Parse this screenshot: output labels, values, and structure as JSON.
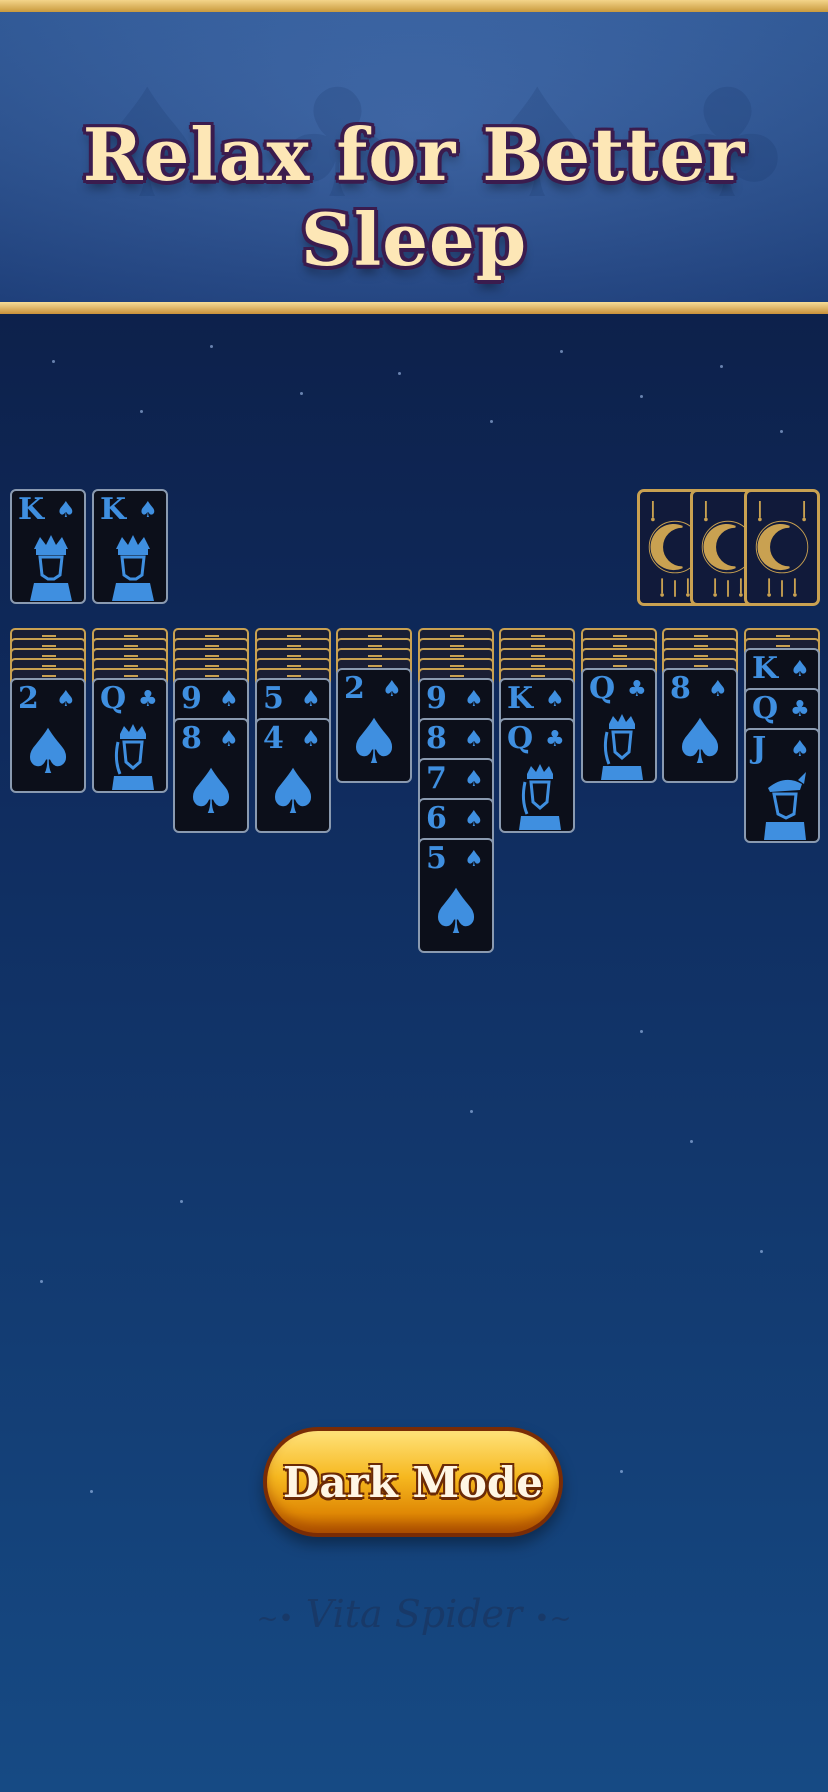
{
  "banner": {
    "title": "Relax for Better Sleep"
  },
  "foundations": [
    {
      "rank": "K",
      "suit": "♠",
      "face": "king"
    },
    {
      "rank": "K",
      "suit": "♠",
      "face": "king"
    }
  ],
  "stock": {
    "count": 3,
    "icon": "crescent-moon-icon"
  },
  "tableau": [
    {
      "hidden": 5,
      "cards": [
        {
          "rank": "2",
          "suit": "♠",
          "face": null
        }
      ]
    },
    {
      "hidden": 5,
      "cards": [
        {
          "rank": "Q",
          "suit": "♣",
          "face": "queen"
        }
      ]
    },
    {
      "hidden": 5,
      "cards": [
        {
          "rank": "9",
          "suit": "♠",
          "face": null
        },
        {
          "rank": "8",
          "suit": "♠",
          "face": null
        }
      ]
    },
    {
      "hidden": 5,
      "cards": [
        {
          "rank": "5",
          "suit": "♠",
          "face": null
        },
        {
          "rank": "4",
          "suit": "♠",
          "face": null
        }
      ]
    },
    {
      "hidden": 4,
      "cards": [
        {
          "rank": "2",
          "suit": "♠",
          "face": null
        }
      ]
    },
    {
      "hidden": 5,
      "cards": [
        {
          "rank": "9",
          "suit": "♠",
          "face": null
        },
        {
          "rank": "8",
          "suit": "♠",
          "face": null
        },
        {
          "rank": "7",
          "suit": "♠",
          "face": null
        },
        {
          "rank": "6",
          "suit": "♠",
          "face": null
        },
        {
          "rank": "5",
          "suit": "♠",
          "face": null
        }
      ]
    },
    {
      "hidden": 5,
      "cards": [
        {
          "rank": "K",
          "suit": "♠",
          "face": null
        },
        {
          "rank": "Q",
          "suit": "♣",
          "face": "queen"
        }
      ]
    },
    {
      "hidden": 4,
      "cards": [
        {
          "rank": "Q",
          "suit": "♣",
          "face": "queen"
        }
      ]
    },
    {
      "hidden": 4,
      "cards": [
        {
          "rank": "8",
          "suit": "♠",
          "face": null
        }
      ]
    },
    {
      "hidden": 2,
      "cards": [
        {
          "rank": "K",
          "suit": "♠",
          "face": null
        },
        {
          "rank": "Q",
          "suit": "♣",
          "face": null
        },
        {
          "rank": "J",
          "suit": "♠",
          "face": "jack"
        }
      ]
    }
  ],
  "button": {
    "label": "Dark Mode"
  },
  "brand": {
    "name": "Vita Spider",
    "ornament_left": "~•",
    "ornament_right": "•~"
  },
  "colors": {
    "card_ink": "#3f8fe0",
    "gold": "#c9a151",
    "banner_text": "#fde7b6"
  }
}
